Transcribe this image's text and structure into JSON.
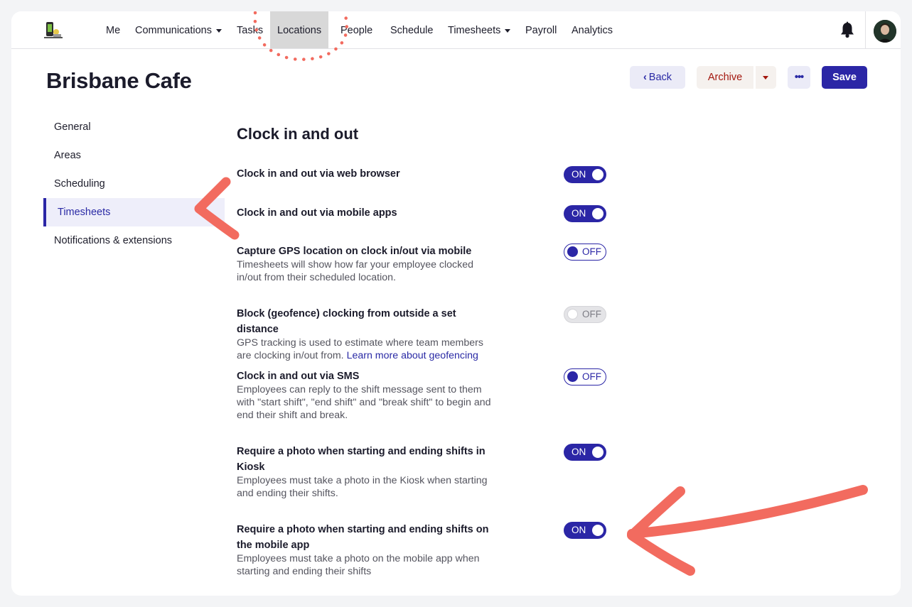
{
  "nav": {
    "items": [
      {
        "label": "Me",
        "dropdown": false
      },
      {
        "label": "Communications",
        "dropdown": true
      },
      {
        "label": "Tasks",
        "dropdown": false
      },
      {
        "label": "Locations",
        "dropdown": false,
        "active": true
      },
      {
        "label": "People",
        "dropdown": false
      },
      {
        "label": "Schedule",
        "dropdown": false
      },
      {
        "label": "Timesheets",
        "dropdown": true
      },
      {
        "label": "Payroll",
        "dropdown": false
      },
      {
        "label": "Analytics",
        "dropdown": false
      }
    ],
    "icons": {
      "bell": "bell-icon",
      "avatar": "user-avatar",
      "logo": "app-logo"
    }
  },
  "header": {
    "title": "Brisbane Cafe",
    "back_label": "Back",
    "archive_label": "Archive",
    "more_label": "•••",
    "save_label": "Save"
  },
  "sidebar": {
    "items": [
      {
        "label": "General"
      },
      {
        "label": "Areas"
      },
      {
        "label": "Scheduling"
      },
      {
        "label": "Timesheets",
        "active": true
      },
      {
        "label": "Notifications & extensions"
      }
    ]
  },
  "content": {
    "section_title": "Clock in and out",
    "settings": [
      {
        "title": "Clock in and out via web browser",
        "description": "",
        "state": "ON"
      },
      {
        "title": "Clock in and out via mobile apps",
        "description": "",
        "state": "ON"
      },
      {
        "title": "Capture GPS location on clock in/out via mobile",
        "description": "Timesheets will show how far your employee clocked in/out from their scheduled location.",
        "state": "OFF"
      },
      {
        "title": "Block (geofence) clocking from outside a set distance",
        "description": "GPS tracking is used to estimate where team members are clocking in/out from.",
        "link": "Learn more about geofencing",
        "state": "OFF",
        "disabled": true
      },
      {
        "title": "Clock in and out via SMS",
        "description": "Employees can reply to the shift message sent to them with \"start shift\", \"end shift\" and \"break shift\" to begin and end their shift and break.",
        "state": "OFF"
      },
      {
        "title": "Require a photo when starting and ending shifts in Kiosk",
        "description": "Employees must take a photo in the Kiosk when starting and ending their shifts.",
        "state": "ON"
      },
      {
        "title": "Require a photo when starting and ending shifts on the mobile app",
        "description": "Employees must take a photo on the mobile app when starting and ending their shifts",
        "state": "ON"
      }
    ]
  },
  "colors": {
    "primary": "#2b26a6",
    "archive_text": "#a3170e",
    "annotation": "#f26b5f"
  }
}
